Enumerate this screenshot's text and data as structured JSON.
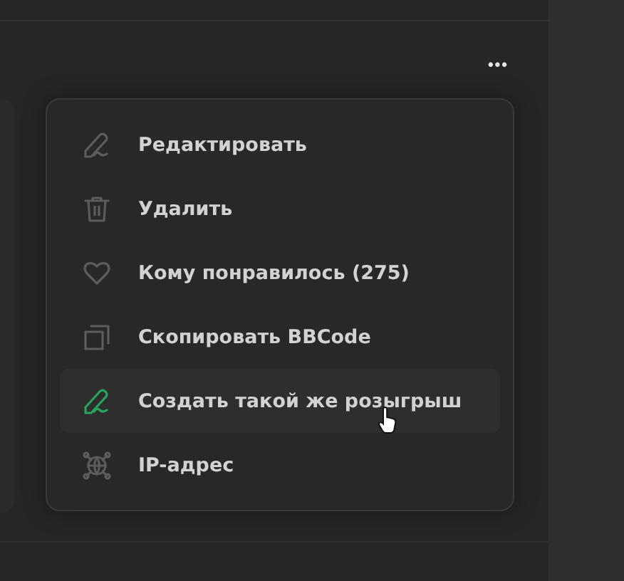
{
  "more_button": {
    "label": "•••"
  },
  "menu": {
    "items": [
      {
        "kind": "edit",
        "label": "Редактировать",
        "selected": false
      },
      {
        "kind": "delete",
        "label": "Удалить",
        "selected": false
      },
      {
        "kind": "like",
        "label": "Кому понравилось (275)",
        "selected": false
      },
      {
        "kind": "copy",
        "label": "Скопировать BBCode",
        "selected": false
      },
      {
        "kind": "edit",
        "label": "Создать такой же розыгрыш",
        "selected": true
      },
      {
        "kind": "ip",
        "label": "IP-адрес",
        "selected": false
      }
    ]
  }
}
